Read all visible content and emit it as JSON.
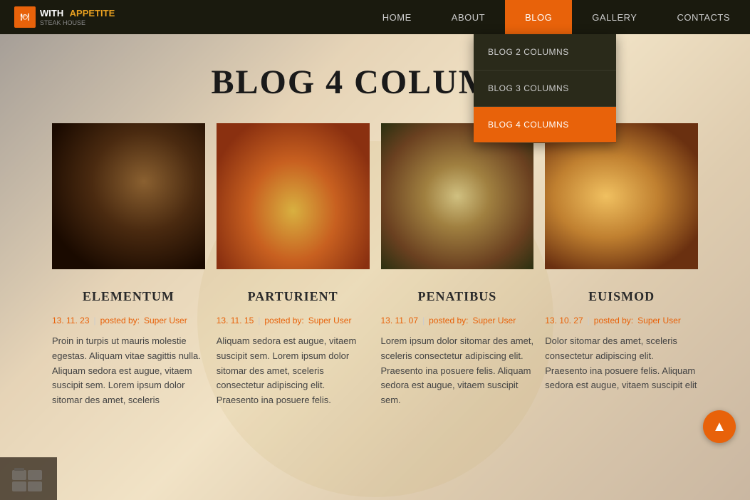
{
  "logo": {
    "with": "WITH",
    "appetite": "APPETITE",
    "sub": "STEAK HOUSE"
  },
  "nav": {
    "items": [
      {
        "label": "HOME",
        "active": false
      },
      {
        "label": "ABOUT",
        "active": false
      },
      {
        "label": "BLOG",
        "active": true
      },
      {
        "label": "GALLERY",
        "active": false
      },
      {
        "label": "CONTACTS",
        "active": false
      }
    ]
  },
  "dropdown": {
    "items": [
      {
        "label": "BLOG 2 COLUMNS",
        "active": false
      },
      {
        "label": "BLOG 3 COLUMNS",
        "active": false
      },
      {
        "label": "BLOG 4 COLUMNS",
        "active": true
      }
    ]
  },
  "page": {
    "title": "BLOG 4 COLUMNS"
  },
  "blog": {
    "cards": [
      {
        "title": "ELEMENTUM",
        "date": "13. 11. 23",
        "author": "Super User",
        "excerpt": "Proin in turpis ut mauris molestie egestas. Aliquam vitae sagittis nulla. Aliquam sedora est augue, vitaem suscipit sem. Lorem ipsum dolor sitomar des amet, sceleris"
      },
      {
        "title": "PARTURIENT",
        "date": "13. 11. 15",
        "author": "Super User",
        "excerpt": "Aliquam sedora est augue, vitaem suscipit sem. Lorem ipsum dolor sitomar des amet, sceleris consectetur adipiscing elit. Praesento ina posuere felis."
      },
      {
        "title": "PENATIBUS",
        "date": "13. 11. 07",
        "author": "Super User",
        "excerpt": "Lorem ipsum dolor sitomar des amet, sceleris consectetur adipiscing elit. Praesento ina posuere felis. Aliquam sedora est augue, vitaem suscipit sem."
      },
      {
        "title": "EUISMOD",
        "date": "13. 10. 27",
        "author": "Super User",
        "excerpt": "Dolor sitomar des amet, sceleris consectetur adipiscing elit. Praesento ina posuere felis. Aliquam sedora est augue, vitaem suscipit elit"
      }
    ]
  },
  "meta": {
    "posted_by": "posted by:"
  },
  "scroll_top": "▲"
}
